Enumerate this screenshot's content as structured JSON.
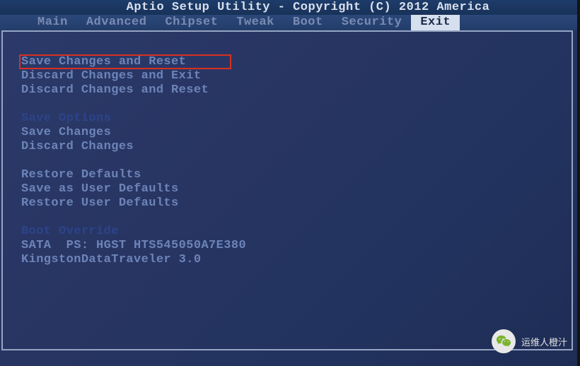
{
  "header": {
    "title": "Aptio Setup Utility - Copyright (C) 2012 America"
  },
  "menu": {
    "items": [
      {
        "label": "Main"
      },
      {
        "label": "Advanced"
      },
      {
        "label": "Chipset"
      },
      {
        "label": "Tweak"
      },
      {
        "label": "Boot"
      },
      {
        "label": "Security"
      },
      {
        "label": "Exit"
      }
    ],
    "active_index": 6
  },
  "exit_panel": {
    "group1": [
      "Save Changes and Reset",
      "Discard Changes and Exit",
      "Discard Changes and Reset"
    ],
    "group2_heading": "Save Options",
    "group2": [
      "Save Changes",
      "Discard Changes"
    ],
    "group3": [
      "Restore Defaults",
      "Save as User Defaults",
      "Restore User Defaults"
    ],
    "boot_override_heading": "Boot Override",
    "boot_override": [
      "SATA  PS: HGST HTS545050A7E380",
      "KingstonDataTraveler 3.0"
    ]
  },
  "highlight": {
    "target_label": "Save Changes and Reset",
    "color": "#d83020"
  },
  "watermark": {
    "text": "运维人橙汁",
    "icon": "wechat-icon"
  }
}
